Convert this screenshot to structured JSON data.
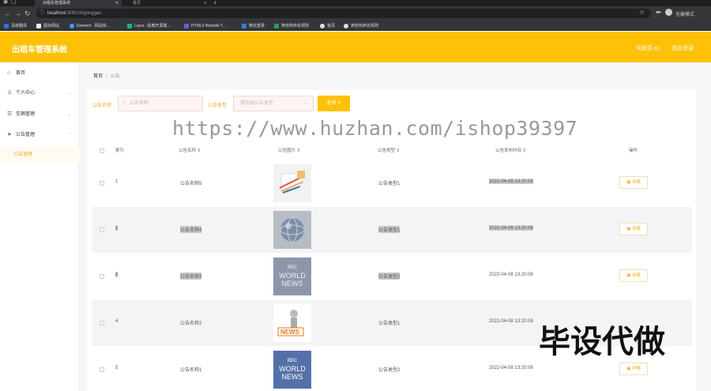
{
  "browser": {
    "tabs": [
      {
        "title": "出租车管理系统",
        "active": true
      },
      {
        "title": "首页",
        "active": false
      }
    ],
    "url_host": "localhost",
    "url_rest": ":8081/#/gonggao",
    "profile": "无痕模式",
    "bookmarks": [
      {
        "label": "百度翻译",
        "color": "#2f6fde"
      },
      {
        "label": "图标网站",
        "color": "#333333"
      },
      {
        "label": "Element - 网站快...",
        "color": "#409eff"
      },
      {
        "label": "Layui - 经典开源模...",
        "color": "#16b777"
      },
      {
        "label": "HTML5 Website T...",
        "color": "#6b5bd6"
      },
      {
        "label": "微信登录",
        "color": "#3a7bd5"
      },
      {
        "label": "表结构命名规则",
        "color": "#2e9c5f"
      },
      {
        "label": "首页",
        "color": "#555555"
      },
      {
        "label": "表结构命名规则",
        "color": "#555555"
      }
    ]
  },
  "header": {
    "title": "出租车管理系统",
    "user_label": "驾驶员 a1",
    "logout_label": "退出登录",
    "accent": "#ffc107"
  },
  "sidebar": {
    "items": [
      {
        "label": "首页",
        "icon": "home-icon"
      },
      {
        "label": "个人中心",
        "icon": "user-icon"
      },
      {
        "label": "车辆管理",
        "icon": "list-icon"
      },
      {
        "label": "公告管理",
        "icon": "send-icon"
      }
    ],
    "submenu_active": "公告管理"
  },
  "breadcrumb": {
    "home": "首页",
    "current": "公告"
  },
  "filters": {
    "name_label": "公告名称",
    "name_placeholder": "公告名称",
    "type_label": "公告类型",
    "type_placeholder": "请选择公告类型",
    "query_label": "查询"
  },
  "table": {
    "columns": [
      "索引",
      "公告名称",
      "公告图片",
      "公告类型",
      "公告发布时间",
      "操作"
    ],
    "detail_label": "详情",
    "rows": [
      {
        "index": "1",
        "name": "公告名称5",
        "image": "pens-on-paper",
        "type": "公告类型1",
        "time": "2022-04-08 13:20:08"
      },
      {
        "index": "2",
        "name": "公告名称4",
        "image": "globe",
        "type": "公告类型1",
        "time": "2022-04-08 13:20:08"
      },
      {
        "index": "3",
        "name": "公告名称3",
        "image": "bbc-world-news-gray",
        "type": "公告类型2",
        "time": "2022-04-08 13:20:08"
      },
      {
        "index": "4",
        "name": "公告名称2",
        "image": "news-figure",
        "type": "公告类型1",
        "time": "2022-04-08 13:20:08"
      },
      {
        "index": "5",
        "name": "公告名称1",
        "image": "bbc-world-news-blue",
        "type": "公告类型2",
        "time": "2022-04-08 13:20:08"
      }
    ],
    "bbc_text": [
      "BBC",
      "WORLD",
      "NEWS"
    ],
    "news_text": "NEWS"
  },
  "overlay": {
    "watermark": "https://www.huzhan.com/ishop39397",
    "stamp": "毕设代做"
  }
}
